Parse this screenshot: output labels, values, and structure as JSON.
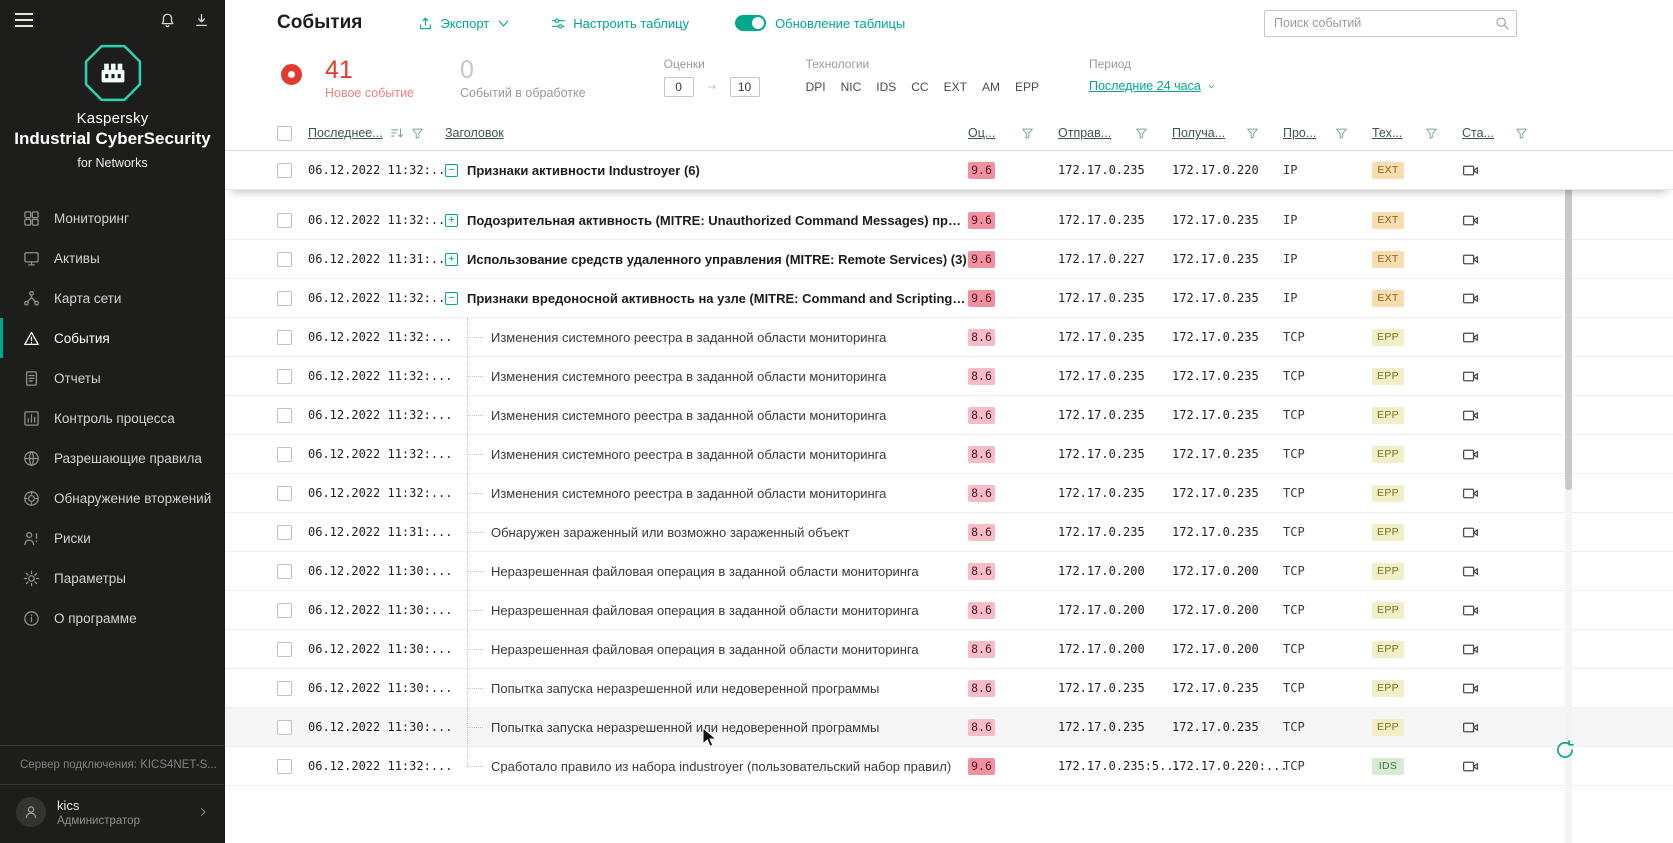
{
  "sidebar": {
    "brand": {
      "name": "Kaspersky",
      "product": "Industrial CyberSecurity",
      "suffix": "for Networks"
    },
    "items": [
      {
        "id": "monitoring",
        "label": "Мониторинг"
      },
      {
        "id": "assets",
        "label": "Активы"
      },
      {
        "id": "network-map",
        "label": "Карта сети"
      },
      {
        "id": "events",
        "label": "События",
        "active": true
      },
      {
        "id": "reports",
        "label": "Отчеты"
      },
      {
        "id": "process-control",
        "label": "Контроль процесса"
      },
      {
        "id": "allow-rules",
        "label": "Разрешающие правила"
      },
      {
        "id": "intrusion-detection",
        "label": "Обнаружение вторжений"
      },
      {
        "id": "risks",
        "label": "Риски"
      },
      {
        "id": "settings",
        "label": "Параметры"
      },
      {
        "id": "about",
        "label": "О программе"
      }
    ],
    "server_label": "Сервер подключения:",
    "server_value": "KICS4NET-S...",
    "user": {
      "name": "kics",
      "role": "Администратор"
    }
  },
  "header": {
    "title": "События",
    "export_label": "Экспорт",
    "configure_label": "Настроить таблицу",
    "refresh_toggle_label": "Обновление таблицы",
    "refresh_toggle_on": true,
    "search_placeholder": "Поиск событий"
  },
  "stats": {
    "new_events_count": "41",
    "new_events_label": "Новое событие",
    "processing_count": "0",
    "processing_label": "Событий в обработке",
    "scores_label": "Оценки",
    "score_min": "0",
    "score_max": "10",
    "tech_label": "Технологии",
    "technologies": [
      "DPI",
      "NIC",
      "IDS",
      "CC",
      "EXT",
      "AM",
      "EPP"
    ],
    "period_label": "Период",
    "period_value": "Последние 24 часа"
  },
  "colors": {
    "accent_teal": "#00a88e",
    "alert_red": "#e23b2e",
    "score_high_bg": "#f2919f",
    "score_mid_bg": "#f6bdc7",
    "tech_ext_bg": "#f7ddb0",
    "tech_epp_bg": "#f1efc8",
    "tech_ids_bg": "#d6ebd2"
  },
  "table": {
    "columns": [
      {
        "key": "time",
        "label": "Последнее...",
        "sort": true,
        "filter": true
      },
      {
        "key": "title",
        "label": "Заголовок",
        "sort": false,
        "filter": false
      },
      {
        "key": "score",
        "label": "Оц...",
        "sort": false,
        "filter": true
      },
      {
        "key": "sender",
        "label": "Отправ...",
        "sort": false,
        "filter": true
      },
      {
        "key": "receiver",
        "label": "Получа...",
        "sort": false,
        "filter": true
      },
      {
        "key": "proto",
        "label": "Про...",
        "sort": false,
        "filter": true
      },
      {
        "key": "tech",
        "label": "Тех...",
        "sort": false,
        "filter": true
      },
      {
        "key": "status",
        "label": "Ста...",
        "sort": false,
        "filter": true
      }
    ],
    "rows": [
      {
        "time": "06.12.2022 11:32:...",
        "expand": "minus",
        "pinned": true,
        "title": "Признаки активности Industroyer (6)",
        "score": "9.6",
        "score_level": "high",
        "sender": "172.17.0.235",
        "receiver": "172.17.0.220",
        "proto": "IP",
        "tech": "EXT"
      },
      {
        "time": "06.12.2022 11:32:...",
        "expand": "plus",
        "title": "Подозрительная активность (MITRE: Unauthorized Command Messages) при взаимо...",
        "score": "9.6",
        "score_level": "high",
        "sender": "172.17.0.235",
        "receiver": "172.17.0.235",
        "proto": "IP",
        "tech": "EXT"
      },
      {
        "time": "06.12.2022 11:31:...",
        "expand": "plus",
        "title": "Использование средств удаленного управления (MITRE: Remote Services) (3)",
        "score": "9.6",
        "score_level": "high",
        "sender": "172.17.0.227",
        "receiver": "172.17.0.235",
        "proto": "IP",
        "tech": "EXT"
      },
      {
        "time": "06.12.2022 11:32:...",
        "expand": "minus",
        "title": "Признаки вредоносной активность на узле (MITRE: Command and Scripting Interpr...",
        "score": "9.6",
        "score_level": "high",
        "sender": "172.17.0.235",
        "receiver": "172.17.0.235",
        "proto": "IP",
        "tech": "EXT"
      },
      {
        "time": "06.12.2022 11:32:...",
        "child": true,
        "title": "Изменения системного реестра в заданной области мониторинга",
        "score": "8.6",
        "score_level": "mid",
        "sender": "172.17.0.235",
        "receiver": "172.17.0.235",
        "proto": "TCP",
        "tech": "EPP"
      },
      {
        "time": "06.12.2022 11:32:...",
        "child": true,
        "title": "Изменения системного реестра в заданной области мониторинга",
        "score": "8.6",
        "score_level": "mid",
        "sender": "172.17.0.235",
        "receiver": "172.17.0.235",
        "proto": "TCP",
        "tech": "EPP"
      },
      {
        "time": "06.12.2022 11:32:...",
        "child": true,
        "title": "Изменения системного реестра в заданной области мониторинга",
        "score": "8.6",
        "score_level": "mid",
        "sender": "172.17.0.235",
        "receiver": "172.17.0.235",
        "proto": "TCP",
        "tech": "EPP"
      },
      {
        "time": "06.12.2022 11:32:...",
        "child": true,
        "title": "Изменения системного реестра в заданной области мониторинга",
        "score": "8.6",
        "score_level": "mid",
        "sender": "172.17.0.235",
        "receiver": "172.17.0.235",
        "proto": "TCP",
        "tech": "EPP"
      },
      {
        "time": "06.12.2022 11:32:...",
        "child": true,
        "title": "Изменения системного реестра в заданной области мониторинга",
        "score": "8.6",
        "score_level": "mid",
        "sender": "172.17.0.235",
        "receiver": "172.17.0.235",
        "proto": "TCP",
        "tech": "EPP"
      },
      {
        "time": "06.12.2022 11:31:...",
        "child": true,
        "title": "Обнаружен зараженный или возможно зараженный объект",
        "score": "8.6",
        "score_level": "mid",
        "sender": "172.17.0.235",
        "receiver": "172.17.0.235",
        "proto": "TCP",
        "tech": "EPP"
      },
      {
        "time": "06.12.2022 11:30:...",
        "child": true,
        "title": "Неразрешенная файловая операция в заданной области мониторинга",
        "score": "8.6",
        "score_level": "mid",
        "sender": "172.17.0.200",
        "receiver": "172.17.0.200",
        "proto": "TCP",
        "tech": "EPP"
      },
      {
        "time": "06.12.2022 11:30:...",
        "child": true,
        "title": "Неразрешенная файловая операция в заданной области мониторинга",
        "score": "8.6",
        "score_level": "mid",
        "sender": "172.17.0.200",
        "receiver": "172.17.0.200",
        "proto": "TCP",
        "tech": "EPP"
      },
      {
        "time": "06.12.2022 11:30:...",
        "child": true,
        "title": "Неразрешенная файловая операция в заданной области мониторинга",
        "score": "8.6",
        "score_level": "mid",
        "sender": "172.17.0.200",
        "receiver": "172.17.0.200",
        "proto": "TCP",
        "tech": "EPP"
      },
      {
        "time": "06.12.2022 11:30:...",
        "child": true,
        "title": "Попытка запуска неразрешенной или недоверенной программы",
        "score": "8.6",
        "score_level": "mid",
        "sender": "172.17.0.235",
        "receiver": "172.17.0.235",
        "proto": "TCP",
        "tech": "EPP"
      },
      {
        "time": "06.12.2022 11:30:...",
        "child": true,
        "hover": true,
        "title": "Попытка запуска неразрешенной или недоверенной программы",
        "score": "8.6",
        "score_level": "mid",
        "sender": "172.17.0.235",
        "receiver": "172.17.0.235",
        "proto": "TCP",
        "tech": "EPP"
      },
      {
        "time": "06.12.2022 11:32:...",
        "child": true,
        "last": true,
        "title": "Сработало правило из набора industroyer (пользовательский набор правил)",
        "score": "9.6",
        "score_level": "high",
        "sender": "172.17.0.235:5...",
        "receiver": "172.17.0.220:...",
        "proto": "TCP",
        "tech": "IDS"
      }
    ]
  }
}
